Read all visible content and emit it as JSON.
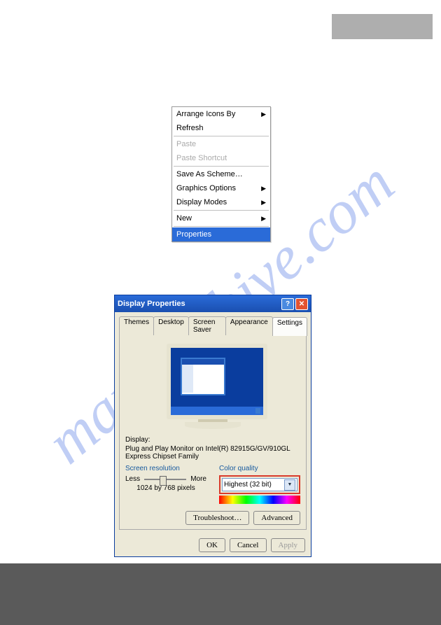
{
  "watermark": "manualshive.com",
  "contextMenu": {
    "arrangeIcons": "Arrange Icons By",
    "refresh": "Refresh",
    "paste": "Paste",
    "pasteShortcut": "Paste Shortcut",
    "saveScheme": "Save As Scheme…",
    "graphicsOptions": "Graphics Options",
    "displayModes": "Display Modes",
    "new": "New",
    "properties": "Properties"
  },
  "dialog": {
    "title": "Display Properties",
    "tabs": {
      "themes": "Themes",
      "desktop": "Desktop",
      "screensaver": "Screen Saver",
      "appearance": "Appearance",
      "settings": "Settings"
    },
    "displayLabel": "Display:",
    "displaySub": "Plug and Play Monitor on Intel(R) 82915G/GV/910GL Express Chipset Family",
    "screenRes": {
      "group": "Screen resolution",
      "less": "Less",
      "more": "More",
      "value": "1024 by 768 pixels"
    },
    "colorQuality": {
      "group": "Color quality",
      "value": "Highest (32 bit)"
    },
    "buttons": {
      "troubleshoot": "Troubleshoot…",
      "advanced": "Advanced",
      "ok": "OK",
      "cancel": "Cancel",
      "apply": "Apply"
    }
  }
}
